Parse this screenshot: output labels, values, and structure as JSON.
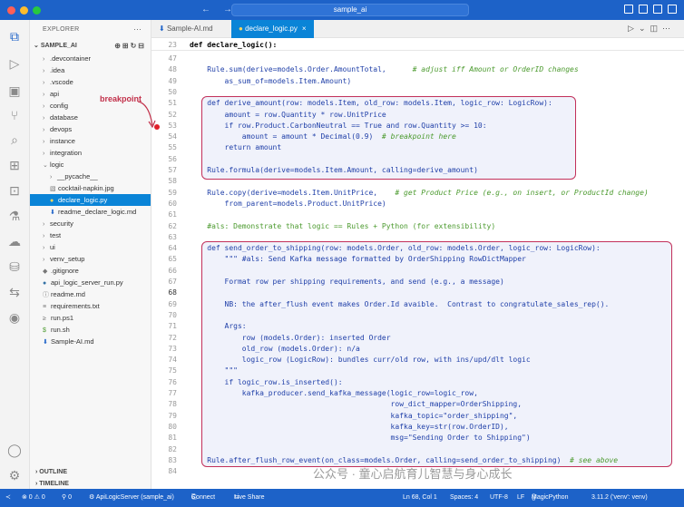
{
  "titlebar": {
    "command_center": "sample_ai"
  },
  "sidebar": {
    "title": "EXPLORER",
    "more": "···",
    "root": "SAMPLE_AI",
    "items": [
      {
        "label": ".devcontainer",
        "type": "folder",
        "expanded": false
      },
      {
        "label": ".idea",
        "type": "folder",
        "expanded": false
      },
      {
        "label": ".vscode",
        "type": "folder",
        "expanded": false
      },
      {
        "label": "api",
        "type": "folder",
        "expanded": false
      },
      {
        "label": "config",
        "type": "folder",
        "expanded": false
      },
      {
        "label": "database",
        "type": "folder",
        "expanded": false
      },
      {
        "label": "devops",
        "type": "folder",
        "expanded": false
      },
      {
        "label": "instance",
        "type": "folder",
        "expanded": false
      },
      {
        "label": "integration",
        "type": "folder",
        "expanded": false
      },
      {
        "label": "logic",
        "type": "folder",
        "expanded": true
      },
      {
        "label": "__pycache__",
        "type": "folder",
        "expanded": false
      },
      {
        "label": "cocktail-napkin.jpg",
        "type": "image"
      },
      {
        "label": "declare_logic.py",
        "type": "python"
      },
      {
        "label": "readme_declare_logic.md",
        "type": "markdown"
      },
      {
        "label": "security",
        "type": "folder",
        "expanded": false
      },
      {
        "label": "test",
        "type": "folder",
        "expanded": false
      },
      {
        "label": "ui",
        "type": "folder",
        "expanded": false
      },
      {
        "label": "venv_setup",
        "type": "folder",
        "expanded": false
      },
      {
        "label": ".gitignore",
        "type": "git"
      },
      {
        "label": "api_logic_server_run.py",
        "type": "python"
      },
      {
        "label": "readme.md",
        "type": "info"
      },
      {
        "label": "requirements.txt",
        "type": "text"
      },
      {
        "label": "run.ps1",
        "type": "shell"
      },
      {
        "label": "run.sh",
        "type": "dollar"
      },
      {
        "label": "Sample-AI.md",
        "type": "markdown"
      }
    ],
    "outline": "OUTLINE",
    "timeline": "TIMELINE"
  },
  "tabs": [
    {
      "label": "Sample-AI.md",
      "active": false
    },
    {
      "label": "declare_logic.py",
      "active": true,
      "close": "×"
    }
  ],
  "annotation": {
    "breakpoint_label": "breakpoint"
  },
  "editor": {
    "sticky": {
      "num": "23",
      "text": "def declare_logic():"
    },
    "lines": [
      {
        "num": "47",
        "text": ""
      },
      {
        "num": "48",
        "text": "    Rule.sum(derive=models.Order.AmountTotal,",
        "comment": "      # adjust iff Amount or OrderID changes"
      },
      {
        "num": "49",
        "text": "        as_sum_of=models.Item.Amount)"
      },
      {
        "num": "50",
        "text": ""
      },
      {
        "num": "51",
        "text": "    def derive_amount(row: models.Item, old_row: models.Item, logic_row: LogicRow):"
      },
      {
        "num": "52",
        "text": "        amount = row.Quantity * row.UnitPrice"
      },
      {
        "num": "53",
        "text": "        if row.Product.CarbonNeutral == True and row.Quantity >= 10:"
      },
      {
        "num": "54",
        "text": "            amount = amount * Decimal(0.9)",
        "comment": "  # breakpoint here"
      },
      {
        "num": "55",
        "text": "        return amount"
      },
      {
        "num": "56",
        "text": ""
      },
      {
        "num": "57",
        "text": "    Rule.formula(derive=models.Item.Amount, calling=derive_amount)"
      },
      {
        "num": "58",
        "text": ""
      },
      {
        "num": "59",
        "text": "    Rule.copy(derive=models.Item.UnitPrice,",
        "comment": "    # get Product Price (e.g., on insert, or ProductId change)"
      },
      {
        "num": "60",
        "text": "        from_parent=models.Product.UnitPrice)"
      },
      {
        "num": "61",
        "text": ""
      },
      {
        "num": "62",
        "text": "    #als: Demonstrate that logic == Rules + Python (for extensibility)"
      },
      {
        "num": "63",
        "text": ""
      },
      {
        "num": "64",
        "text": "    def send_order_to_shipping(row: models.Order, old_row: models.Order, logic_row: LogicRow):"
      },
      {
        "num": "65",
        "text": "        \"\"\" #als: Send Kafka message formatted by OrderShipping RowDictMapper"
      },
      {
        "num": "66",
        "text": ""
      },
      {
        "num": "67",
        "text": "        Format row per shipping requirements, and send (e.g., a message)"
      },
      {
        "num": "68",
        "text": ""
      },
      {
        "num": "69",
        "text": "        NB: the after_flush event makes Order.Id avaible.  Contrast to congratulate_sales_rep()."
      },
      {
        "num": "70",
        "text": ""
      },
      {
        "num": "71",
        "text": "        Args:"
      },
      {
        "num": "72",
        "text": "            row (models.Order): inserted Order"
      },
      {
        "num": "73",
        "text": "            old_row (models.Order): n/a"
      },
      {
        "num": "74",
        "text": "            logic_row (LogicRow): bundles curr/old row, with ins/upd/dlt logic"
      },
      {
        "num": "75",
        "text": "        \"\"\""
      },
      {
        "num": "76",
        "text": "        if logic_row.is_inserted():"
      },
      {
        "num": "77",
        "text": "            kafka_producer.send_kafka_message(logic_row=logic_row,"
      },
      {
        "num": "78",
        "text": "                                              row_dict_mapper=OrderShipping,"
      },
      {
        "num": "79",
        "text": "                                              kafka_topic=\"order_shipping\","
      },
      {
        "num": "80",
        "text": "                                              kafka_key=str(row.OrderID),"
      },
      {
        "num": "81",
        "text": "                                              msg=\"Sending Order to Shipping\")"
      },
      {
        "num": "82",
        "text": ""
      },
      {
        "num": "83",
        "text": "    Rule.after_flush_row_event(on_class=models.Order, calling=send_order_to_shipping)",
        "comment": "  # see above"
      },
      {
        "num": "84",
        "text": ""
      }
    ]
  },
  "watermark": "公众号 · 童心启航育儿智慧与身心成长",
  "status": {
    "remote": "≺",
    "problems": "⊗ 0 ⚠ 0",
    "ports": "⚲ 0",
    "debug": "⚙ ApiLogicServer (sample_ai)",
    "connect": "Connect",
    "live_share": "Live Share",
    "position": "Ln 68, Col 1",
    "spaces": "Spaces: 4",
    "encoding": "UTF-8",
    "eol": "LF",
    "language": "MagicPython",
    "interpreter": "3.11.2 ('venv': venv)"
  },
  "colors": {
    "accent": "#1d62c8",
    "selection": "#0a84d7",
    "highlight_border": "#c2305a",
    "breakpoint": "#e0202a"
  }
}
